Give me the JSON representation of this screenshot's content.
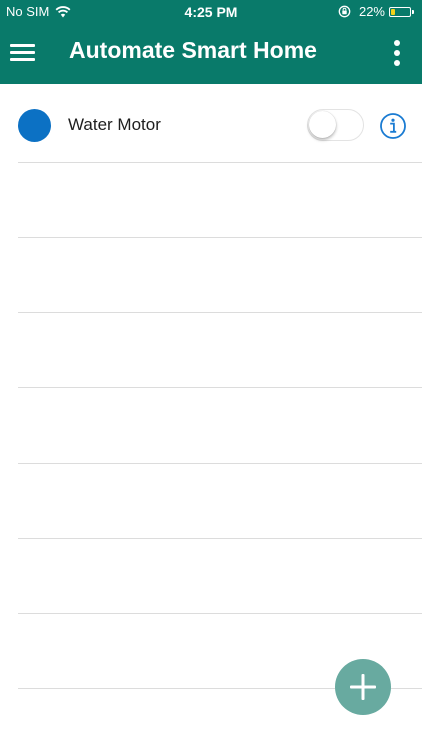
{
  "status_bar": {
    "carrier": "No SIM",
    "time": "4:25 PM",
    "battery_text": "22%",
    "battery_level": 0.22,
    "icons": [
      "wifi-icon",
      "orientation-lock-icon",
      "battery-icon"
    ]
  },
  "app_bar": {
    "title": "Automate Smart Home",
    "icons": [
      "hamburger-menu-icon",
      "more-vertical-icon"
    ]
  },
  "devices": [
    {
      "name": "Water Motor",
      "status_color": "#0c71c4",
      "toggle_on": false,
      "icons": [
        "info-icon"
      ]
    }
  ],
  "fab": {
    "icon": "plus-icon"
  },
  "colors": {
    "app_bar": "#097a6a",
    "fab": "#68aaa0",
    "accent_blue": "#1a7bd2",
    "battery": "#f4d21a",
    "divider": "#dcdcdc"
  }
}
